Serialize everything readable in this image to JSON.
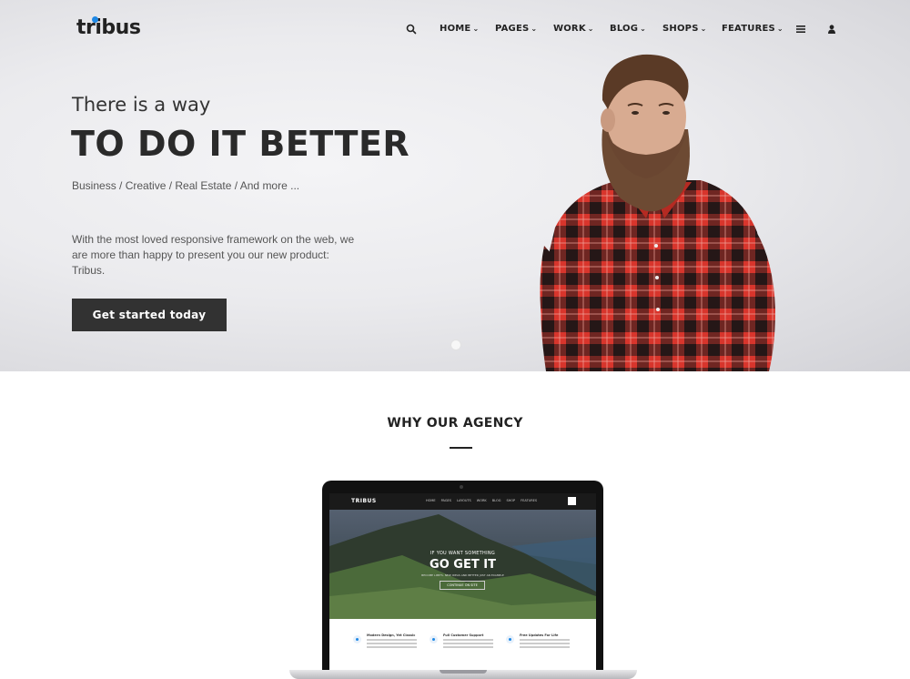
{
  "brand": {
    "logo_text": "tribus",
    "accent_color": "#1e88e5"
  },
  "nav": {
    "search_icon": "search-icon",
    "items": [
      {
        "label": "HOME"
      },
      {
        "label": "PAGES"
      },
      {
        "label": "WORK"
      },
      {
        "label": "BLOG"
      },
      {
        "label": "SHOPS"
      },
      {
        "label": "FEATURES"
      }
    ],
    "menu_icon": "hamburger-icon",
    "user_icon": "user-icon"
  },
  "hero": {
    "eyebrow": "There is a way",
    "headline": "TO DO IT BETTER",
    "subline": "Business / Creative / Real Estate / And more ...",
    "description": "With the most loved responsive framework on the web, we are more than happy to present you our new product: Tribus.",
    "cta_label": "Get started today",
    "cta_color": "#323232"
  },
  "section": {
    "title": "WHY OUR AGENCY"
  },
  "laptop_screen": {
    "brand": "TRIBUS",
    "nav_links": [
      "HOME",
      "PAGES",
      "LAYOUTS",
      "WORK",
      "BLOG",
      "SHOP",
      "FEATURES"
    ],
    "eyebrow": "IF YOU WANT SOMETHING",
    "headline": "GO GET IT",
    "subline": "BECOME LIMITS. NEW IDEAS AND BETTER JUST AN EXAMPLE",
    "button": "CONTINUE ON SITE",
    "features": [
      {
        "title": "Modern Design, Yet Classic"
      },
      {
        "title": "Full Customer Support"
      },
      {
        "title": "Free Updates For Life"
      }
    ]
  }
}
